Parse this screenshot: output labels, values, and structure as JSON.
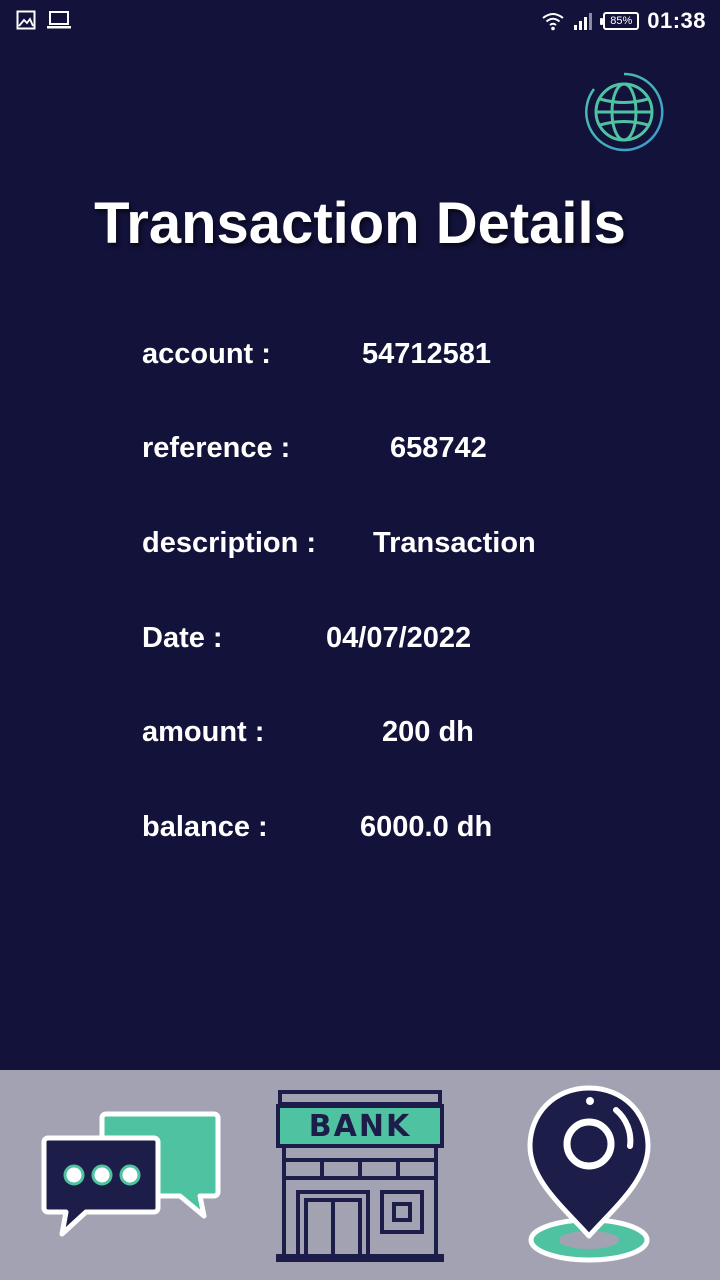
{
  "status_bar": {
    "time": "01:38",
    "battery": "85%",
    "icons": [
      "image-icon",
      "laptop-icon",
      "wifi-icon",
      "signal-icon",
      "battery-icon"
    ]
  },
  "header": {
    "globe_icon": "globe-icon",
    "title": "Transaction Details"
  },
  "details": [
    {
      "label": "account :",
      "value": "54712581"
    },
    {
      "label": "reference :",
      "value": "658742"
    },
    {
      "label": "description :",
      "value": "Transaction"
    },
    {
      "label": "Date :",
      "value": "04/07/2022"
    },
    {
      "label": "amount :",
      "value": "200 dh"
    },
    {
      "label": "balance :",
      "value": "6000.0 dh"
    }
  ],
  "bottom_nav": {
    "items": [
      {
        "icon": "chat-icon"
      },
      {
        "icon": "bank-icon",
        "sign_text": "BANK"
      },
      {
        "icon": "location-pin-icon"
      }
    ]
  },
  "colors": {
    "background": "#12123a",
    "accent_green": "#4fc3a1",
    "navy": "#1d1d4a",
    "bottom_bar": "#a2a2b2"
  }
}
